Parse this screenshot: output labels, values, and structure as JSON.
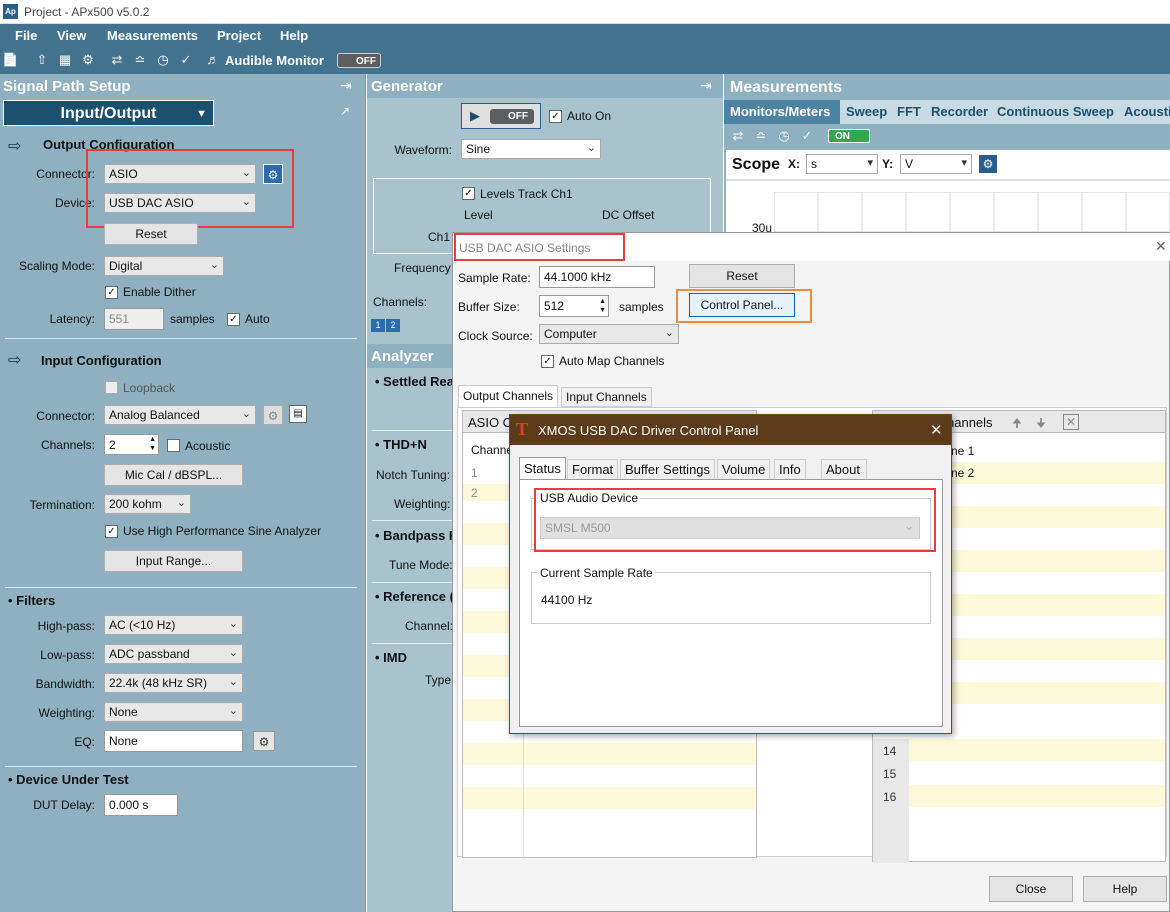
{
  "window": {
    "title": "Project - APx500 v5.0.2",
    "logo": "Ap"
  },
  "menu": [
    "File",
    "View",
    "Measurements",
    "Project",
    "Help"
  ],
  "toolbar": {
    "audible_monitor": "Audible Monitor",
    "monitor_state": "OFF"
  },
  "signal_path": {
    "title": "Signal Path Setup",
    "selector": "Input/Output",
    "output_config": {
      "header": "Output Configuration",
      "connector_label": "Connector:",
      "connector": "ASIO",
      "device_label": "Device:",
      "device": "USB DAC ASIO",
      "reset": "Reset",
      "scaling_label": "Scaling Mode:",
      "scaling": "Digital",
      "dither": "Enable Dither",
      "latency_label": "Latency:",
      "latency": "551",
      "latency_unit": "samples",
      "latency_auto": "Auto"
    },
    "input_config": {
      "header": "Input Configuration",
      "loopback": "Loopback",
      "connector_label": "Connector:",
      "connector": "Analog Balanced",
      "channels_label": "Channels:",
      "channels": "2",
      "acoustic": "Acoustic",
      "miccal": "Mic Cal / dBSPL...",
      "termination_label": "Termination:",
      "termination": "200 kohm",
      "hp_sine": "Use High Performance Sine Analyzer",
      "input_range": "Input Range..."
    },
    "filters": {
      "header": "Filters",
      "highpass_label": "High-pass:",
      "highpass": "AC (<10 Hz)",
      "lowpass_label": "Low-pass:",
      "lowpass": "ADC passband",
      "bandwidth_label": "Bandwidth:",
      "bandwidth": "22.4k (48 kHz SR)",
      "weighting_label": "Weighting:",
      "weighting": "None",
      "eq_label": "EQ:",
      "eq": "None"
    },
    "dut": {
      "header": "Device Under Test",
      "delay_label": "DUT Delay:",
      "delay": "0.000 s"
    }
  },
  "generator": {
    "title": "Generator",
    "state": "OFF",
    "auto_on": "Auto On",
    "waveform_label": "Waveform:",
    "waveform": "Sine",
    "levels_track": "Levels Track Ch1",
    "level_label": "Level",
    "dc_offset_label": "DC Offset",
    "ch1_label": "Ch1",
    "frequency_label": "Frequency",
    "channels_label": "Channels:",
    "ch_buttons": [
      "1",
      "2"
    ]
  },
  "analyzer": {
    "title": "Analyzer",
    "sections": [
      "Settled Rea",
      "THD+N",
      "Bandpass F",
      "Reference (",
      "IMD"
    ],
    "notch_label": "Notch Tuning:",
    "weighting_label": "Weighting:",
    "tune_label": "Tune Mode:",
    "channel_label": "Channel:",
    "type_label": "Type:"
  },
  "measurements": {
    "title": "Measurements",
    "tabs": [
      "Monitors/Meters",
      "Sweep",
      "FFT",
      "Recorder",
      "Continuous Sweep",
      "Acousti"
    ],
    "on_label": "ON",
    "scope_label": "Scope",
    "x_label": "X:",
    "x_unit": "s",
    "y_label": "Y:",
    "y_unit": "V",
    "y_tick": "30u"
  },
  "asio_dialog": {
    "title": "USB DAC ASIO Settings",
    "sample_rate_label": "Sample Rate:",
    "sample_rate": "44.1000 kHz",
    "buffer_label": "Buffer Size:",
    "buffer": "512",
    "buffer_unit": "samples",
    "clock_label": "Clock Source:",
    "clock": "Computer",
    "auto_map": "Auto Map Channels",
    "reset": "Reset",
    "control_panel": "Control Panel...",
    "tabs": [
      "Output Channels",
      "Input Channels"
    ],
    "out_col": "ASIO O",
    "chan_col": "Channe",
    "rows_left": [
      "1",
      "2"
    ],
    "in_col": "hannels",
    "rows_right_names": [
      "ne 1",
      "ne 2"
    ],
    "rows_right_nums": [
      "14",
      "15",
      "16"
    ],
    "close": "Close",
    "help": "Help"
  },
  "xmos_dialog": {
    "title": "XMOS USB DAC Driver Control Panel",
    "tabs": [
      "Status",
      "Format",
      "Buffer Settings",
      "Volume",
      "Info",
      "About"
    ],
    "usb_device_label": "USB Audio Device",
    "usb_device": "SMSL M500",
    "rate_label": "Current Sample Rate",
    "rate": "44100 Hz"
  },
  "colors": {
    "panel": "#8fb0c0",
    "header": "#43738f",
    "highlight_red": "#e53e3e",
    "highlight_orange": "#f08c3c"
  }
}
